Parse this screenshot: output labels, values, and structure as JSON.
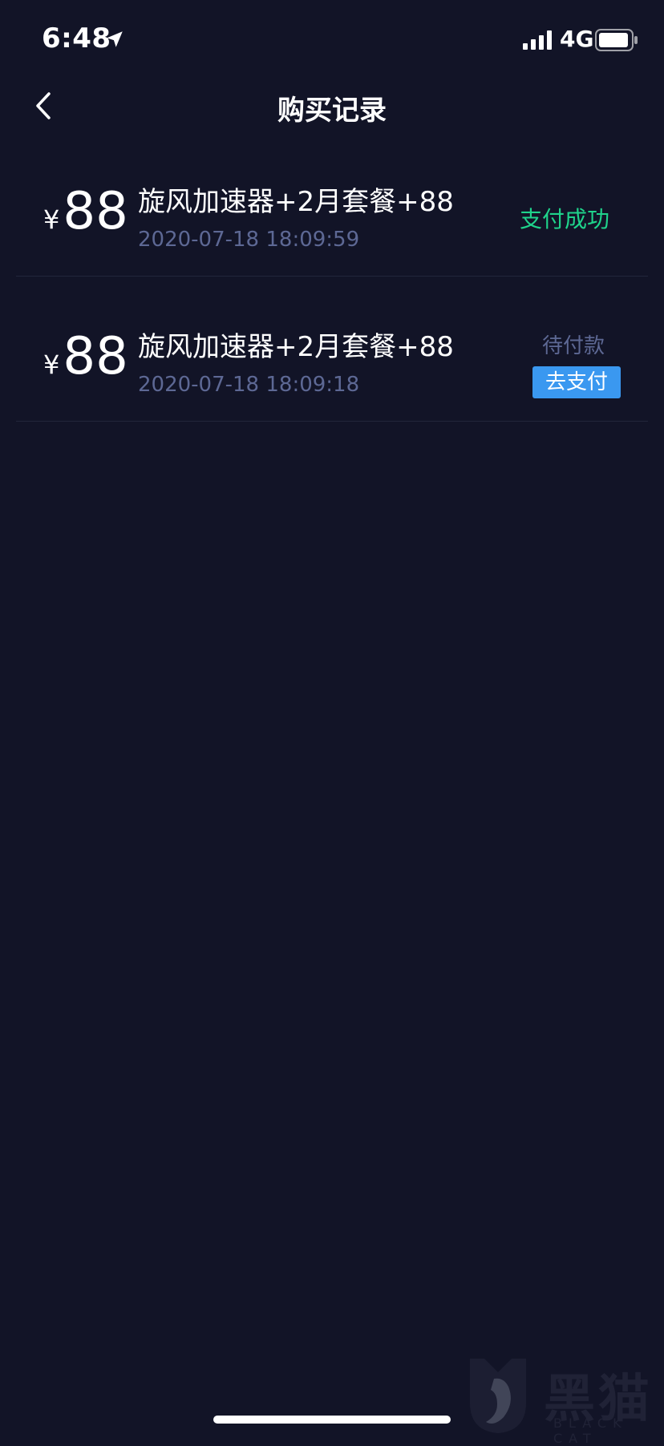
{
  "status_bar": {
    "time": "6:48",
    "network": "4G"
  },
  "nav": {
    "title": "购买记录"
  },
  "records": [
    {
      "currency": "¥",
      "amount": "88",
      "title": "旋风加速器+2月套餐+88",
      "time": "2020-07-18 18:09:59",
      "status": "支付成功"
    },
    {
      "currency": "¥",
      "amount": "88",
      "title": "旋风加速器+2月套餐+88",
      "time": "2020-07-18 18:09:18",
      "status": "待付款",
      "action_label": "去支付"
    }
  ],
  "watermark": {
    "text": "黑猫",
    "sub": "BLACK CAT"
  },
  "colors": {
    "background": "#121427",
    "success": "#1fd38b",
    "muted": "#5d6894",
    "accent": "#3a98f0"
  },
  "icons": {
    "back": "chevron-left-icon",
    "location": "location-arrow-icon",
    "signal": "signal-bars-icon",
    "battery": "battery-icon"
  }
}
